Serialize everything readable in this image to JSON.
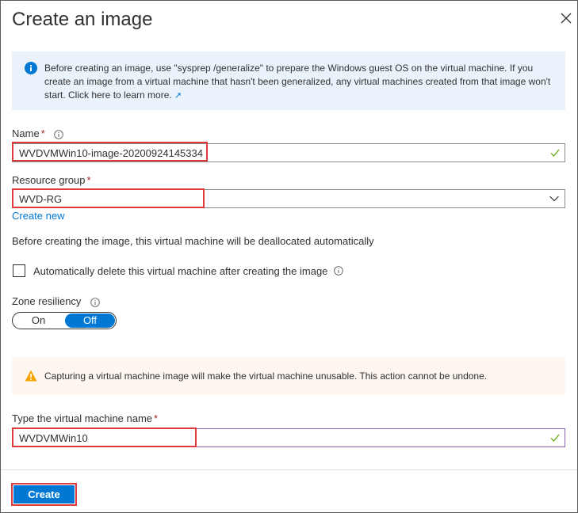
{
  "title": "Create an image",
  "info": {
    "text": "Before creating an image, use \"sysprep /generalize\" to prepare the Windows guest OS on the virtual machine. If you create an image from a virtual machine that hasn't been generalized, any virtual machines created from that image won't start. Click here to learn more.",
    "link_icon": "↗"
  },
  "name_field": {
    "label": "Name",
    "required_mark": "*",
    "value": "WVDVMWin10-image-20200924145334"
  },
  "resource_group": {
    "label": "Resource group",
    "required_mark": "*",
    "value": "WVD-RG",
    "create_new": "Create new"
  },
  "dealloc_note": "Before creating the image, this virtual machine will be deallocated automatically",
  "auto_delete": {
    "label": "Automatically delete this virtual machine after creating the image",
    "checked": false
  },
  "zone_resiliency": {
    "label": "Zone resiliency",
    "on_label": "On",
    "off_label": "Off",
    "selected": "Off"
  },
  "warning": {
    "text": "Capturing a virtual machine image will make the virtual machine unusable. This action cannot be undone."
  },
  "vm_name_field": {
    "label": "Type the virtual machine name",
    "required_mark": "*",
    "value": "WVDVMWin10"
  },
  "create_button": "Create",
  "colors": {
    "accent": "#0078d4",
    "highlight": "#e0393e",
    "valid": "#57a300",
    "warning": "#f7a300"
  }
}
